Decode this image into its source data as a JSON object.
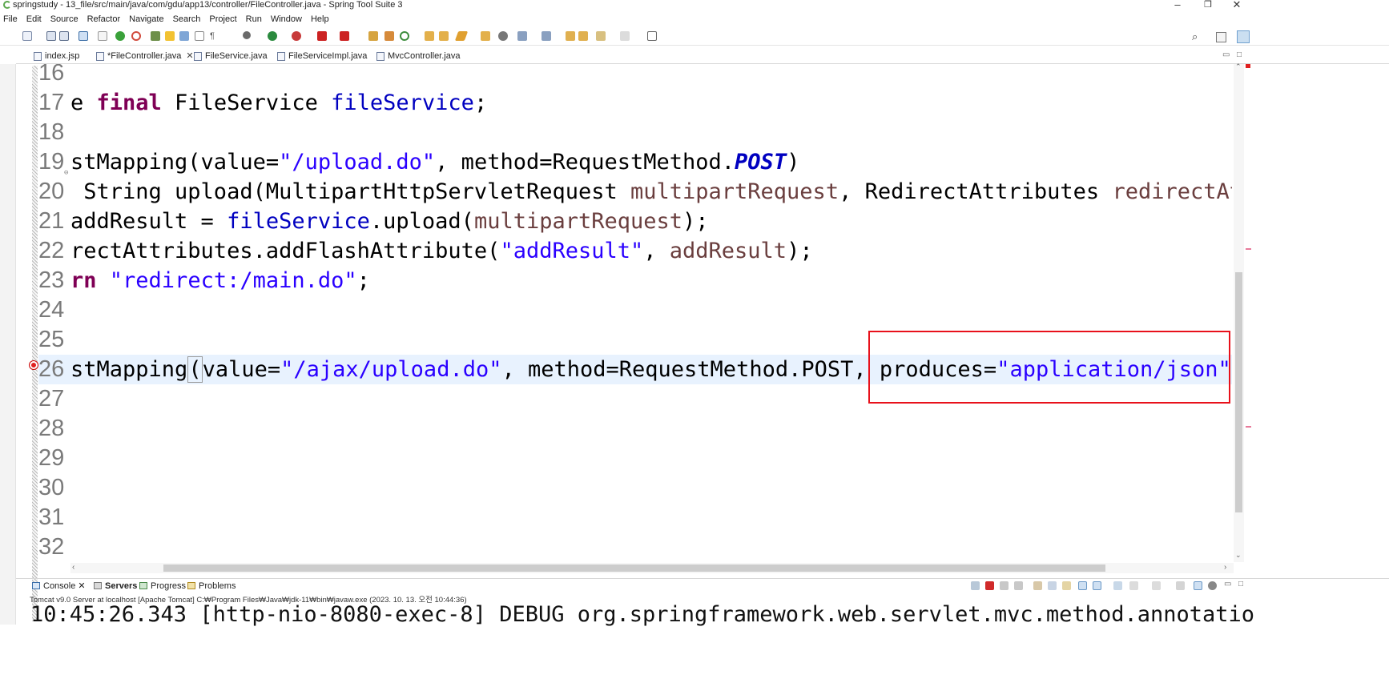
{
  "window": {
    "title": "springstudy - 13_file/src/main/java/com/gdu/app13/controller/FileController.java - Spring Tool Suite 3",
    "minimize": "–",
    "restore": "❐",
    "close": "✕"
  },
  "menu": [
    "File",
    "Edit",
    "Source",
    "Refactor",
    "Navigate",
    "Search",
    "Project",
    "Run",
    "Window",
    "Help"
  ],
  "tabs": [
    {
      "label": "index.jsp",
      "active": false
    },
    {
      "label": "*FileController.java",
      "active": true,
      "close": "✕"
    },
    {
      "label": "FileService.java",
      "active": false
    },
    {
      "label": "FileServiceImpl.java",
      "active": false
    },
    {
      "label": "MvcController.java",
      "active": false
    }
  ],
  "editor": {
    "lines": [
      {
        "num": "16"
      },
      {
        "num": "17"
      },
      {
        "num": "18"
      },
      {
        "num": "19"
      },
      {
        "num": "20"
      },
      {
        "num": "21"
      },
      {
        "num": "22"
      },
      {
        "num": "23"
      },
      {
        "num": "24"
      },
      {
        "num": "25"
      },
      {
        "num": "26"
      },
      {
        "num": "27"
      },
      {
        "num": "28"
      },
      {
        "num": "29"
      },
      {
        "num": "30"
      },
      {
        "num": "31"
      },
      {
        "num": "32"
      }
    ],
    "l17": {
      "a": "e ",
      "kw": "final",
      "b": " FileService ",
      "fld": "fileService",
      "c": ";"
    },
    "l19": {
      "a": "stMapping(value=",
      "str": "\"/upload.do\"",
      "b": ", method=RequestMethod.",
      "ital": "POST",
      "c": ")"
    },
    "l20": {
      "a": " String upload(MultipartHttpServletRequest ",
      "p1": "multipartRequest",
      "b": ", RedirectAttributes ",
      "p2": "redirectAt"
    },
    "l21": {
      "a": "addResult = ",
      "fld": "fileService",
      "b": ".upload(",
      "p": "multipartRequest",
      "c": ");"
    },
    "l22": {
      "a": "rectAttributes.addFlashAttribute(",
      "str": "\"addResult\"",
      "b": ", ",
      "p": "addResult",
      "c": ");"
    },
    "l23": {
      "a": "rn ",
      "str": "\"redirect:/main.do\"",
      "c": ";"
    },
    "l26": {
      "a": "stMapping",
      "br": "(",
      "b": "value=",
      "str1": "\"/ajax/upload.do\"",
      "c": ", method=RequestMethod.POST, ",
      "d": "produces=",
      "str2": "\"application/json\"",
      "e": ")"
    }
  },
  "console": {
    "tabs": [
      {
        "label": "Console",
        "close": "✕",
        "active": false
      },
      {
        "label": "Servers",
        "active": true
      },
      {
        "label": "Progress",
        "active": false
      },
      {
        "label": "Problems",
        "active": false
      }
    ],
    "info": "Tomcat v9.0 Server at localhost [Apache Tomcat] C:₩Program Files₩Java₩jdk-11₩bin₩javaw.exe  (2023. 10. 13. 오전 10:44:36)",
    "output": "10:45:26.343 [http-nio-8080-exec-8] DEBUG org.springframework.web.servlet.mvc.method.annotatio"
  },
  "colors": {
    "keyword": "#7f0055",
    "string": "#2a00ff",
    "field": "#0000c0",
    "highlight_box": "#e8111b",
    "current_line": "#e8f2fe"
  }
}
